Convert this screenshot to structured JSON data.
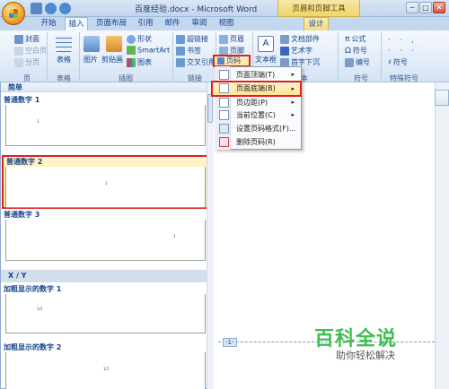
{
  "window": {
    "title": "百度经验.docx - Microsoft Word",
    "context_tools": "页眉和页脚工具",
    "min": "─",
    "max": "□",
    "close": "✕"
  },
  "tabs": [
    "开始",
    "插入",
    "页面布局",
    "引用",
    "邮件",
    "审阅",
    "视图",
    "设计"
  ],
  "active_tab": "插入",
  "ribbon": {
    "pages": {
      "cover": "封面",
      "blank": "空白页",
      "break": "分页",
      "label": "页"
    },
    "tables": {
      "table": "表格",
      "label": "表格"
    },
    "illustrations": {
      "picture": "图片",
      "clipart": "剪贴画",
      "shapes": "形状",
      "smartart": "SmartArt",
      "chart": "图表",
      "label": "插图"
    },
    "links": {
      "hyperlink": "超链接",
      "bookmark": "书签",
      "crossref": "交叉引用",
      "label": "链接"
    },
    "header_footer": {
      "header": "页眉",
      "footer": "页脚",
      "page_number": "页码"
    },
    "text": {
      "textbox": "文本框",
      "quickparts": "文档部件",
      "wordart": "艺术字",
      "dropcap": "首字下沉",
      "label": "文本"
    },
    "symbols": {
      "equation": "公式",
      "symbol": "符号",
      "number": "编号",
      "label": "符号"
    },
    "special": {
      "symbol": "符号",
      "label": "特殊符号"
    }
  },
  "page_number_menu": {
    "items": [
      {
        "label": "页面顶端(T)",
        "has_submenu": true
      },
      {
        "label": "页面底端(B)",
        "has_submenu": true,
        "highlighted": true
      },
      {
        "label": "页边距(P)",
        "has_submenu": true
      },
      {
        "label": "当前位置(C)",
        "has_submenu": true
      },
      {
        "label": "设置页码格式(F)...",
        "has_submenu": false
      },
      {
        "label": "删除页码(R)",
        "has_submenu": false
      }
    ]
  },
  "gallery": {
    "header": "简单",
    "items": [
      {
        "label": "普通数字 1",
        "align": "left",
        "number": "1"
      },
      {
        "label": "普通数字 2",
        "align": "center",
        "number": "1",
        "selected": true
      },
      {
        "label": "普通数字 3",
        "align": "right",
        "number": "1"
      }
    ],
    "category2": "X / Y",
    "bold_items": [
      {
        "label": "加粗显示的数字 1",
        "align": "left",
        "number": "1/1"
      },
      {
        "label": "加粗显示的数字 2",
        "align": "center",
        "number": "1/1"
      }
    ]
  },
  "document": {
    "page_tag": "-1-"
  },
  "watermark": {
    "main": "百科全说",
    "sub": "助你轻松解决"
  },
  "colors": {
    "highlight_border": "#e02020",
    "ribbon_bg": "#dfeaf7",
    "watermark": "#3fbf4f"
  }
}
